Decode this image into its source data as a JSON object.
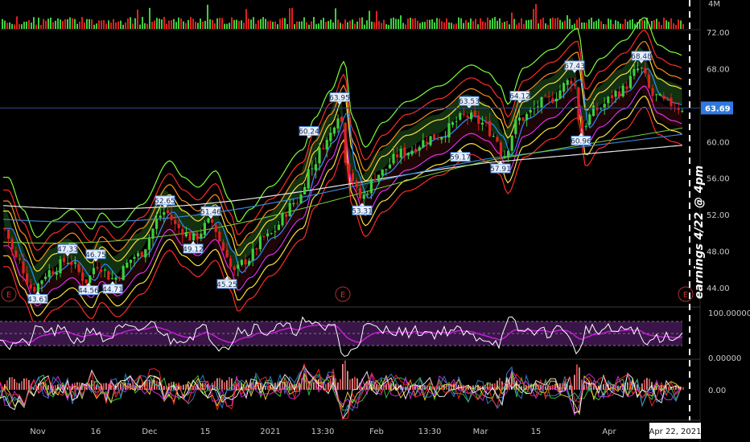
{
  "colors": {
    "background": "#000000",
    "up": "#3ecf3e",
    "down": "#e02020",
    "price_line": "#2e4a8a",
    "badge": "#2f7ae0",
    "rsi_band": "#3a1648",
    "rsi_line": "#ffffff",
    "rsi_signal": "#c21fd6",
    "earnings": "#b03030",
    "cursor": "#ffffff"
  },
  "chart_data": {
    "type": "candlestick",
    "price_axis": {
      "ticks": [
        "72.00",
        "68.00",
        "64.00",
        "60.00",
        "56.00",
        "52.00",
        "48.00",
        "44.00"
      ],
      "ylim": [
        42,
        73
      ]
    },
    "volume_axis": {
      "tick": "4M"
    },
    "rsi_axis": {
      "ticks": [
        "100.00000",
        "0.00000"
      ]
    },
    "oscillator_axis": {
      "ticks": [
        "0.00"
      ]
    },
    "x_labels": [
      "Nov",
      "16",
      "Dec",
      "15",
      "2021",
      "13:30",
      "Feb",
      "13:30",
      "Mar",
      "15",
      "Apr"
    ],
    "cursor_date": "Apr 22, 2021",
    "last_price": "63.69",
    "annotation": "earnings 4/22 @ 4pm",
    "earnings_marker": "E",
    "callouts": [
      {
        "label": "43.61",
        "value": 43.61,
        "pos": "below"
      },
      {
        "label": "47.33",
        "value": 47.33,
        "pos": "above"
      },
      {
        "label": "44.56",
        "value": 44.56,
        "pos": "below"
      },
      {
        "label": "46.75",
        "value": 46.75,
        "pos": "above"
      },
      {
        "label": "44.71",
        "value": 44.71,
        "pos": "below"
      },
      {
        "label": "52.65",
        "value": 52.65,
        "pos": "above"
      },
      {
        "label": "49.12",
        "value": 49.12,
        "pos": "below"
      },
      {
        "label": "51.46",
        "value": 51.46,
        "pos": "above"
      },
      {
        "label": "45.25",
        "value": 45.25,
        "pos": "below"
      },
      {
        "label": "60.24",
        "value": 60.24,
        "pos": "above"
      },
      {
        "label": "63.95",
        "value": 63.95,
        "pos": "above"
      },
      {
        "label": "53.31",
        "value": 53.31,
        "pos": "below"
      },
      {
        "label": "63.53",
        "value": 63.53,
        "pos": "above"
      },
      {
        "label": "59.17",
        "value": 59.17,
        "pos": "below"
      },
      {
        "label": "64.12",
        "value": 64.12,
        "pos": "above"
      },
      {
        "label": "57.91",
        "value": 57.91,
        "pos": "below"
      },
      {
        "label": "67.43",
        "value": 67.43,
        "pos": "above"
      },
      {
        "label": "60.96",
        "value": 60.96,
        "pos": "below"
      },
      {
        "label": "68.48",
        "value": 68.48,
        "pos": "above"
      }
    ]
  }
}
